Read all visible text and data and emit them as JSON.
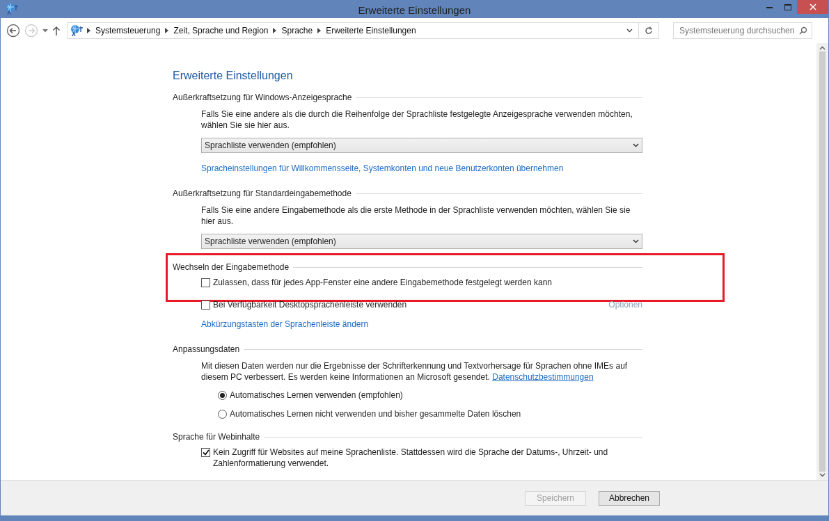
{
  "window": {
    "title": "Erweiterte Einstellungen"
  },
  "address_bar": {
    "breadcrumbs": [
      "Systemsteuerung",
      "Zeit, Sprache und Region",
      "Sprache",
      "Erweiterte Einstellungen"
    ]
  },
  "search": {
    "placeholder": "Systemsteuerung durchsuchen"
  },
  "page_title": "Erweiterte Einstellungen",
  "sections": [
    {
      "title": "Außerkraftsetzung für Windows-Anzeigesprache",
      "highlighted": false,
      "items": [
        {
          "kind": "text",
          "text": "Falls Sie eine andere als die durch die Reihenfolge der Sprachliste festgelegte Anzeigesprache verwenden möchten, wählen Sie sie hier aus."
        },
        {
          "kind": "select",
          "value": "Sprachliste verwenden (empfohlen)"
        },
        {
          "kind": "link",
          "text": "Spracheinstellungen für Willkommensseite, Systemkonten und neue Benutzerkonten übernehmen"
        }
      ]
    },
    {
      "title": "Außerkraftsetzung für Standardeingabemethode",
      "highlighted": false,
      "items": [
        {
          "kind": "text",
          "text": "Falls Sie eine andere Eingabemethode als die erste Methode in der Sprachliste verwenden möchten, wählen Sie sie hier aus."
        },
        {
          "kind": "select",
          "value": "Sprachliste verwenden (empfohlen)"
        }
      ]
    },
    {
      "title": "Wechseln der Eingabemethode",
      "highlighted": true,
      "items": [
        {
          "kind": "checkbox",
          "label": "Zulassen, dass für jedes App-Fenster eine andere Eingabemethode festgelegt werden kann",
          "checked": false
        }
      ]
    },
    {
      "highlighted": false,
      "items": [
        {
          "kind": "checkbox",
          "label": "Bei Verfügbarkeit Desktopsprachenleiste verwenden",
          "checked": false,
          "option_link": "Optionen"
        },
        {
          "kind": "link",
          "text": "Abkürzungstasten der Sprachenleiste ändern"
        }
      ]
    },
    {
      "title": "Anpassungsdaten",
      "highlighted": false,
      "items": [
        {
          "kind": "text",
          "text": "Mit diesen Daten werden nur die Ergebnisse der Schrifterkennung und Textvorhersage für Sprachen ohne IMEs auf diesem PC verbessert. Es werden keine Informationen an Microsoft gesendet.",
          "link": "Datenschutzbestimmungen"
        },
        {
          "kind": "radio",
          "label": "Automatisches Lernen verwenden (empfohlen)",
          "selected": true
        },
        {
          "kind": "radio",
          "label": "Automatisches Lernen nicht verwenden und bisher gesammelte Daten löschen",
          "selected": false
        }
      ]
    },
    {
      "title": "Sprache für Webinhalte",
      "highlighted": false,
      "items": [
        {
          "kind": "checkbox",
          "label": "Kein Zugriff für Websites auf meine Sprachenliste. Stattdessen wird die Sprache der Datums-, Uhrzeit- und Zahlenformatierung verwendet.",
          "checked": true
        }
      ]
    }
  ],
  "buttons": [
    {
      "label": "Speichern",
      "disabled": true
    },
    {
      "label": "Abbrechen",
      "disabled": false
    }
  ]
}
